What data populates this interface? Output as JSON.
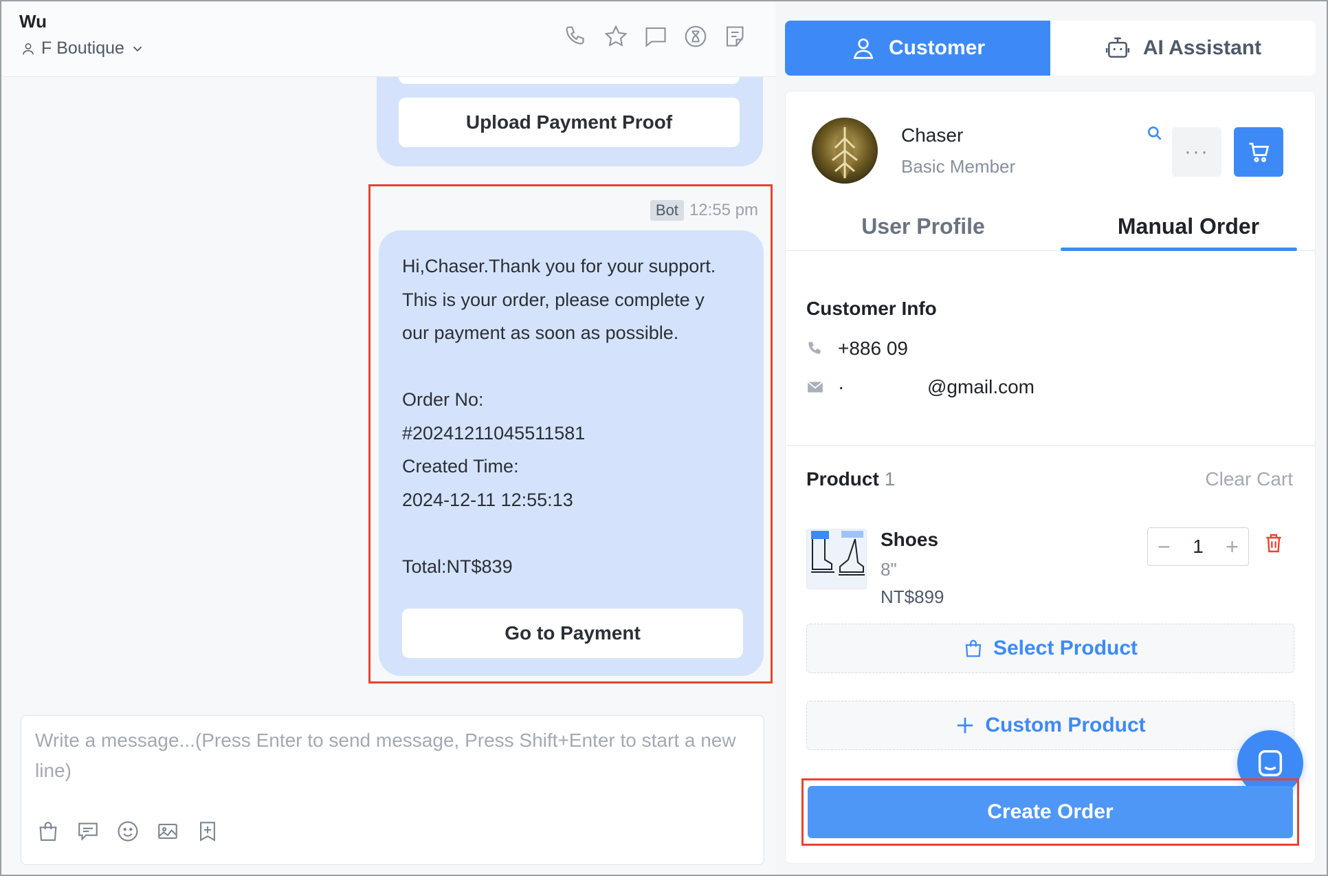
{
  "chat": {
    "contact_name": "Wu",
    "store_name": "F Boutique",
    "header_icons": [
      "phone-icon",
      "star-icon",
      "message-square-icon",
      "hourglass-icon",
      "note-icon"
    ],
    "previous_button": "Upload Payment Proof",
    "message": {
      "sender_tag": "Bot",
      "time": "12:55 pm",
      "lines": [
        "Hi,Chaser.Thank you for your support.",
        "This is your order, please complete y",
        "our payment as soon as possible.",
        "",
        "Order No:",
        "#20241211045511581",
        "Created Time:",
        "2024-12-11 12:55:13",
        "",
        "Total:NT$839"
      ],
      "button": "Go to Payment"
    },
    "composer": {
      "placeholder": "Write a message...(Press Enter to send message, Press Shift+Enter to start a new line)",
      "tools": [
        "shopping-bag-icon",
        "quick-reply-icon",
        "emoji-icon",
        "image-icon",
        "bookmark-add-icon"
      ]
    }
  },
  "right": {
    "top_tabs": [
      {
        "label": "Customer",
        "icon": "person-icon",
        "active": true
      },
      {
        "label": "AI Assistant",
        "icon": "robot-icon",
        "active": false
      }
    ],
    "customer": {
      "name": "Chaser",
      "level": "Basic Member",
      "more_label": "···"
    },
    "sub_tabs": [
      {
        "label": "User Profile",
        "active": false
      },
      {
        "label": "Manual Order",
        "active": true
      }
    ],
    "info": {
      "title": "Customer Info",
      "phone": "+886 09",
      "email_prefix": "·",
      "email_suffix": "@gmail.com"
    },
    "product": {
      "title": "Product",
      "count": "1",
      "clear_cart": "Clear Cart",
      "items": [
        {
          "name": "Shoes",
          "size": "8\"",
          "price": "NT$899",
          "quantity": "1"
        }
      ],
      "stepper_minus": "−",
      "stepper_plus": "+",
      "select_product": "Select Product",
      "custom_product": "Custom Product"
    },
    "create_order": "Create Order"
  },
  "colors": {
    "accent": "#3d8af7",
    "bubble": "#d4e3fb",
    "highlight": "#e8432f",
    "danger": "#e8432f"
  }
}
